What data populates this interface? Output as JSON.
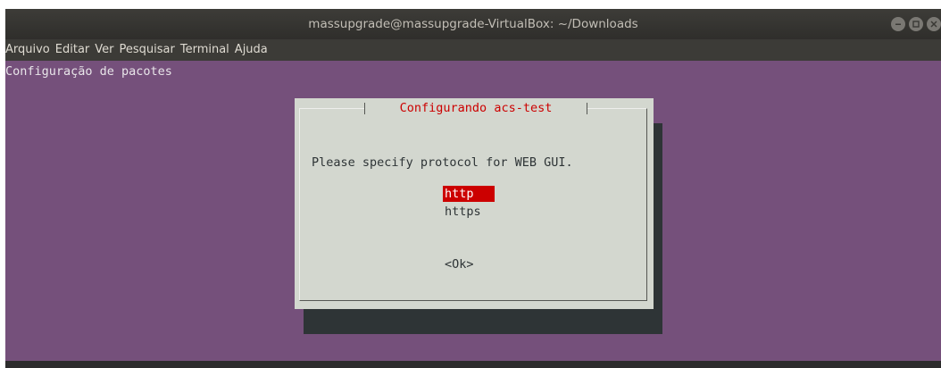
{
  "window": {
    "title": "massupgrade@massupgrade-VirtualBox: ~/Downloads"
  },
  "menubar": {
    "items": [
      "Arquivo",
      "Editar",
      "Ver",
      "Pesquisar",
      "Terminal",
      "Ajuda"
    ]
  },
  "terminal": {
    "header_text": "Configuração de pacotes"
  },
  "dialog": {
    "title": "Configurando acs-test",
    "prompt": "Please specify protocol for WEB GUI.",
    "options": [
      "http",
      "https"
    ],
    "selected_option": "http",
    "ok_label": "<Ok>"
  },
  "colors": {
    "terminal_bg": "#75507b",
    "dialog_bg": "#d3d7cf",
    "title_color": "#cc0000",
    "selection_bg": "#cc0000",
    "shadow": "#2e3436"
  },
  "icons": [
    "minimize-icon",
    "maximize-icon",
    "close-icon"
  ]
}
